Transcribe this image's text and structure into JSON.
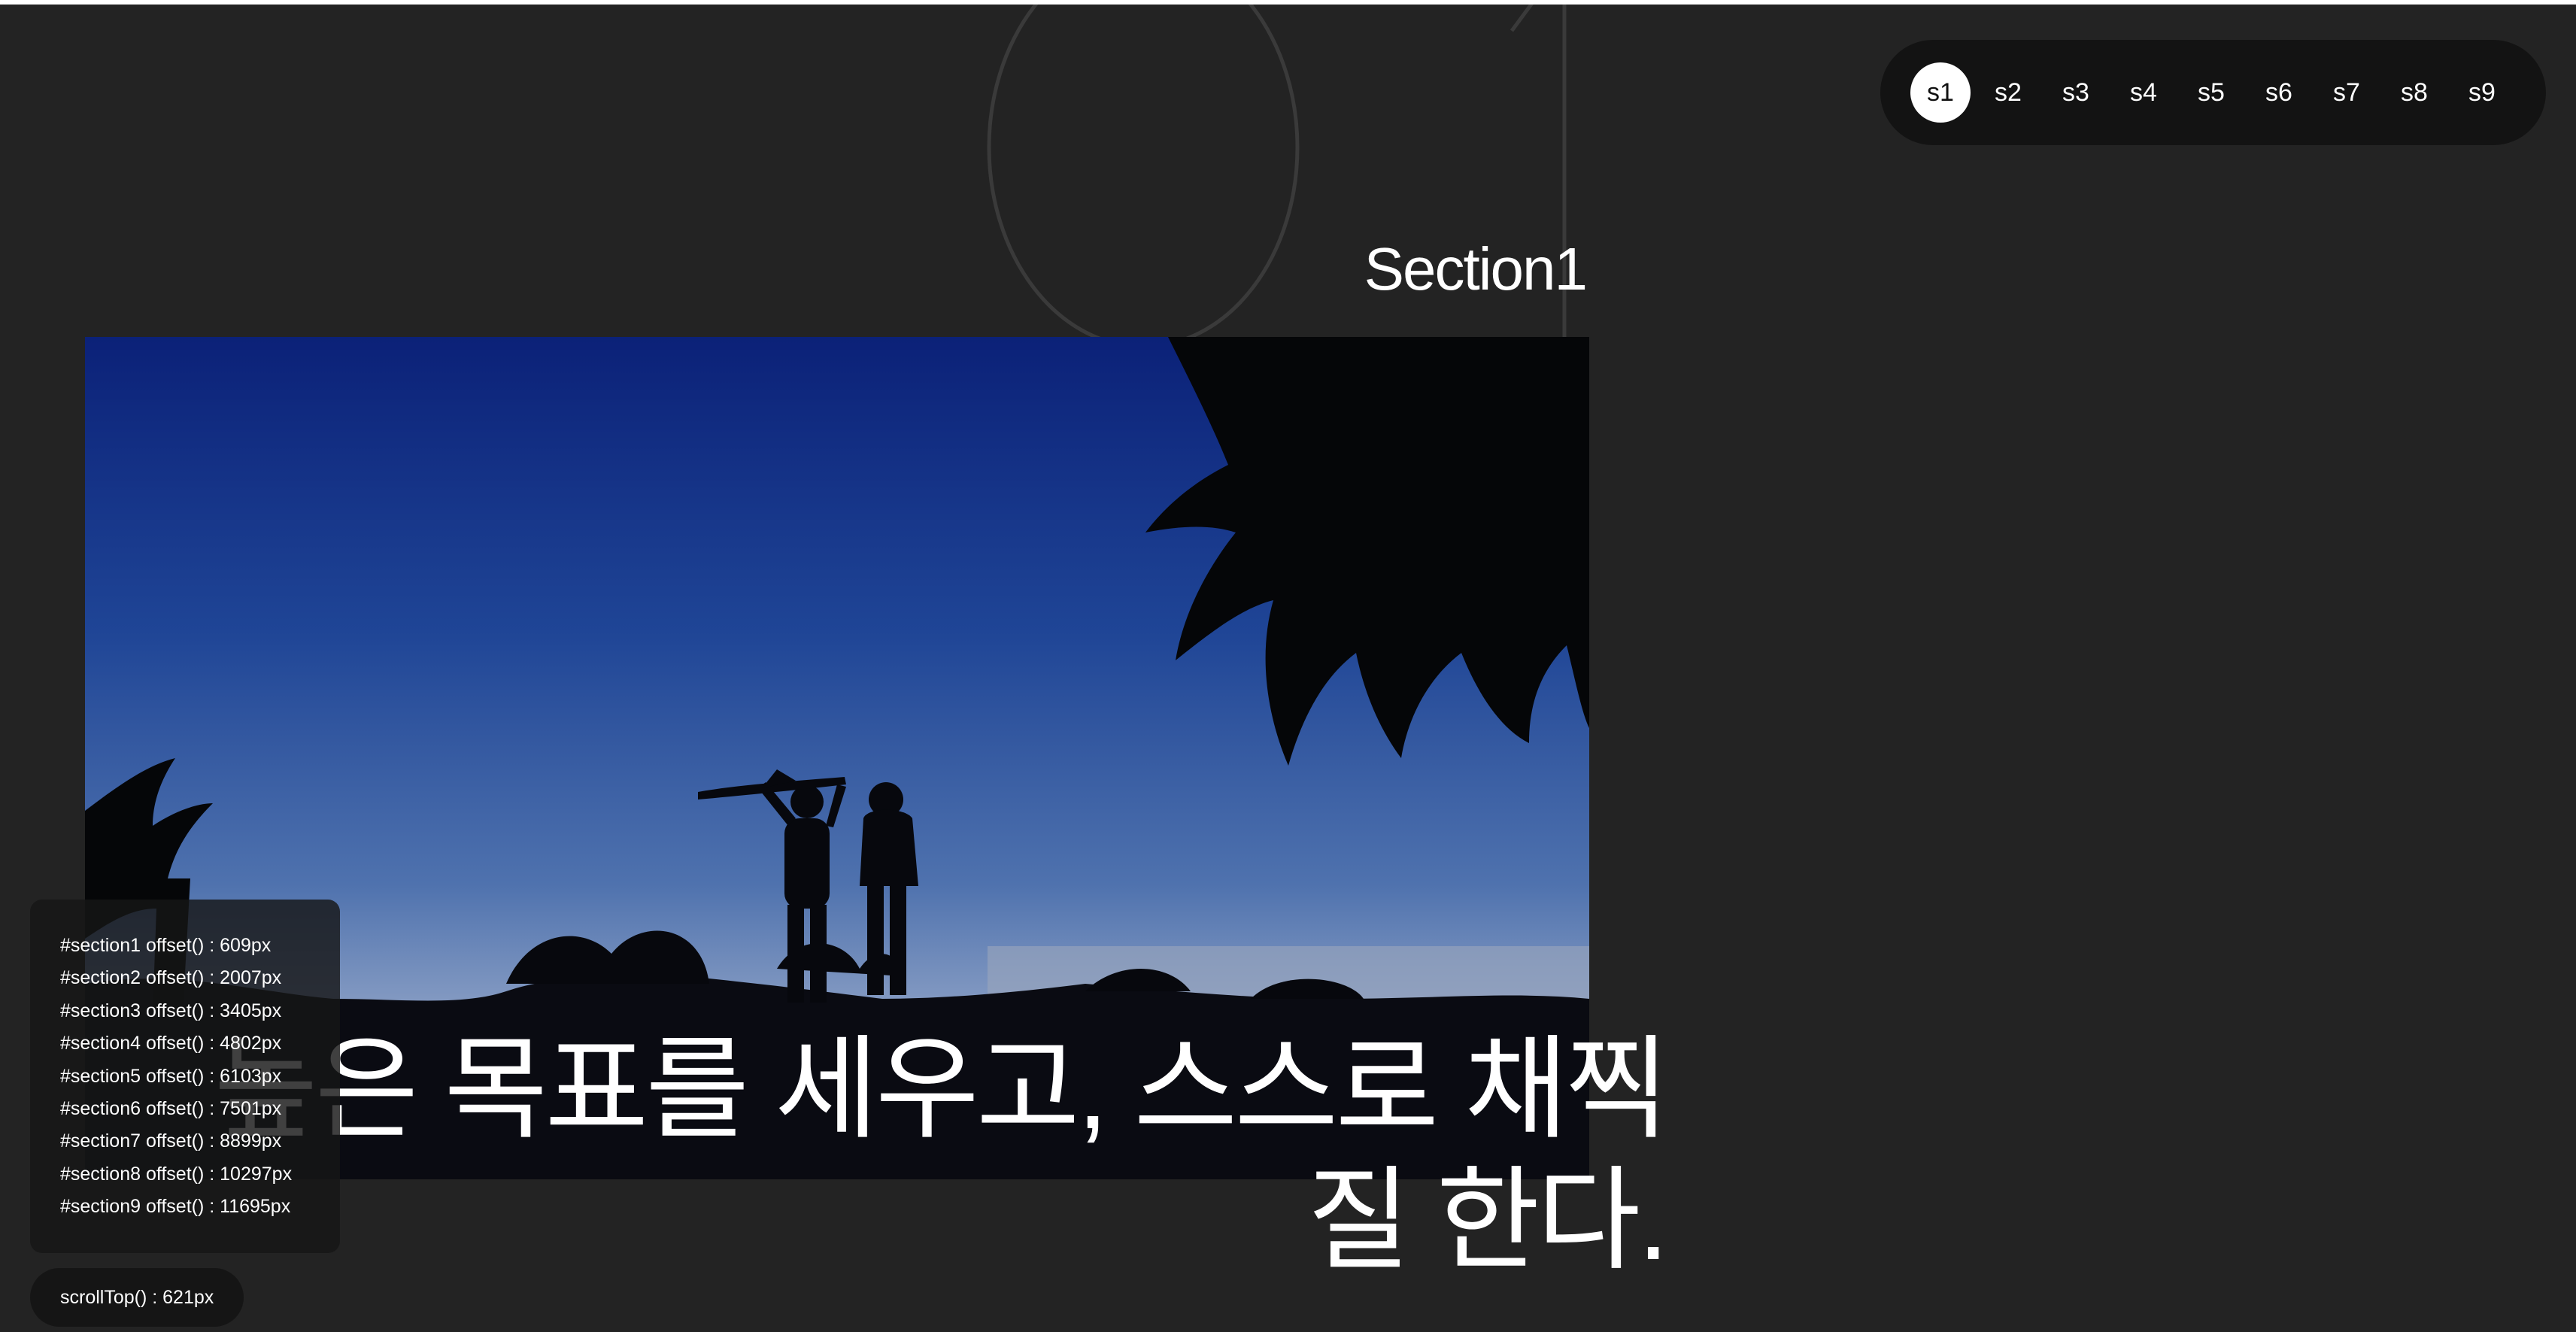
{
  "section": {
    "title": "Section1",
    "headline": "높은 목표를 세우고, 스스로 채찍질 한다."
  },
  "nav": {
    "items": [
      {
        "label": "s1",
        "active": true
      },
      {
        "label": "s2",
        "active": false
      },
      {
        "label": "s3",
        "active": false
      },
      {
        "label": "s4",
        "active": false
      },
      {
        "label": "s5",
        "active": false
      },
      {
        "label": "s6",
        "active": false
      },
      {
        "label": "s7",
        "active": false
      },
      {
        "label": "s8",
        "active": false
      },
      {
        "label": "s9",
        "active": false
      }
    ]
  },
  "offsets": [
    "#section1 offset() : 609px",
    "#section2 offset() : 2007px",
    "#section3 offset() : 3405px",
    "#section4 offset() : 4802px",
    "#section5 offset() : 6103px",
    "#section6 offset() : 7501px",
    "#section7 offset() : 8899px",
    "#section8 offset() : 10297px",
    "#section9 offset() : 11695px"
  ],
  "scroll": {
    "label": "scrollTop() : 621px"
  },
  "colors": {
    "background": "#232323",
    "nav_bg": "#131313",
    "active_dot": "#ffffff",
    "sky_top": "#0d2a82",
    "sky_horizon": "#8fa3c4"
  },
  "image": {
    "subject": "silhouette of two people launching a model airplane at dusk under a palm tree"
  }
}
